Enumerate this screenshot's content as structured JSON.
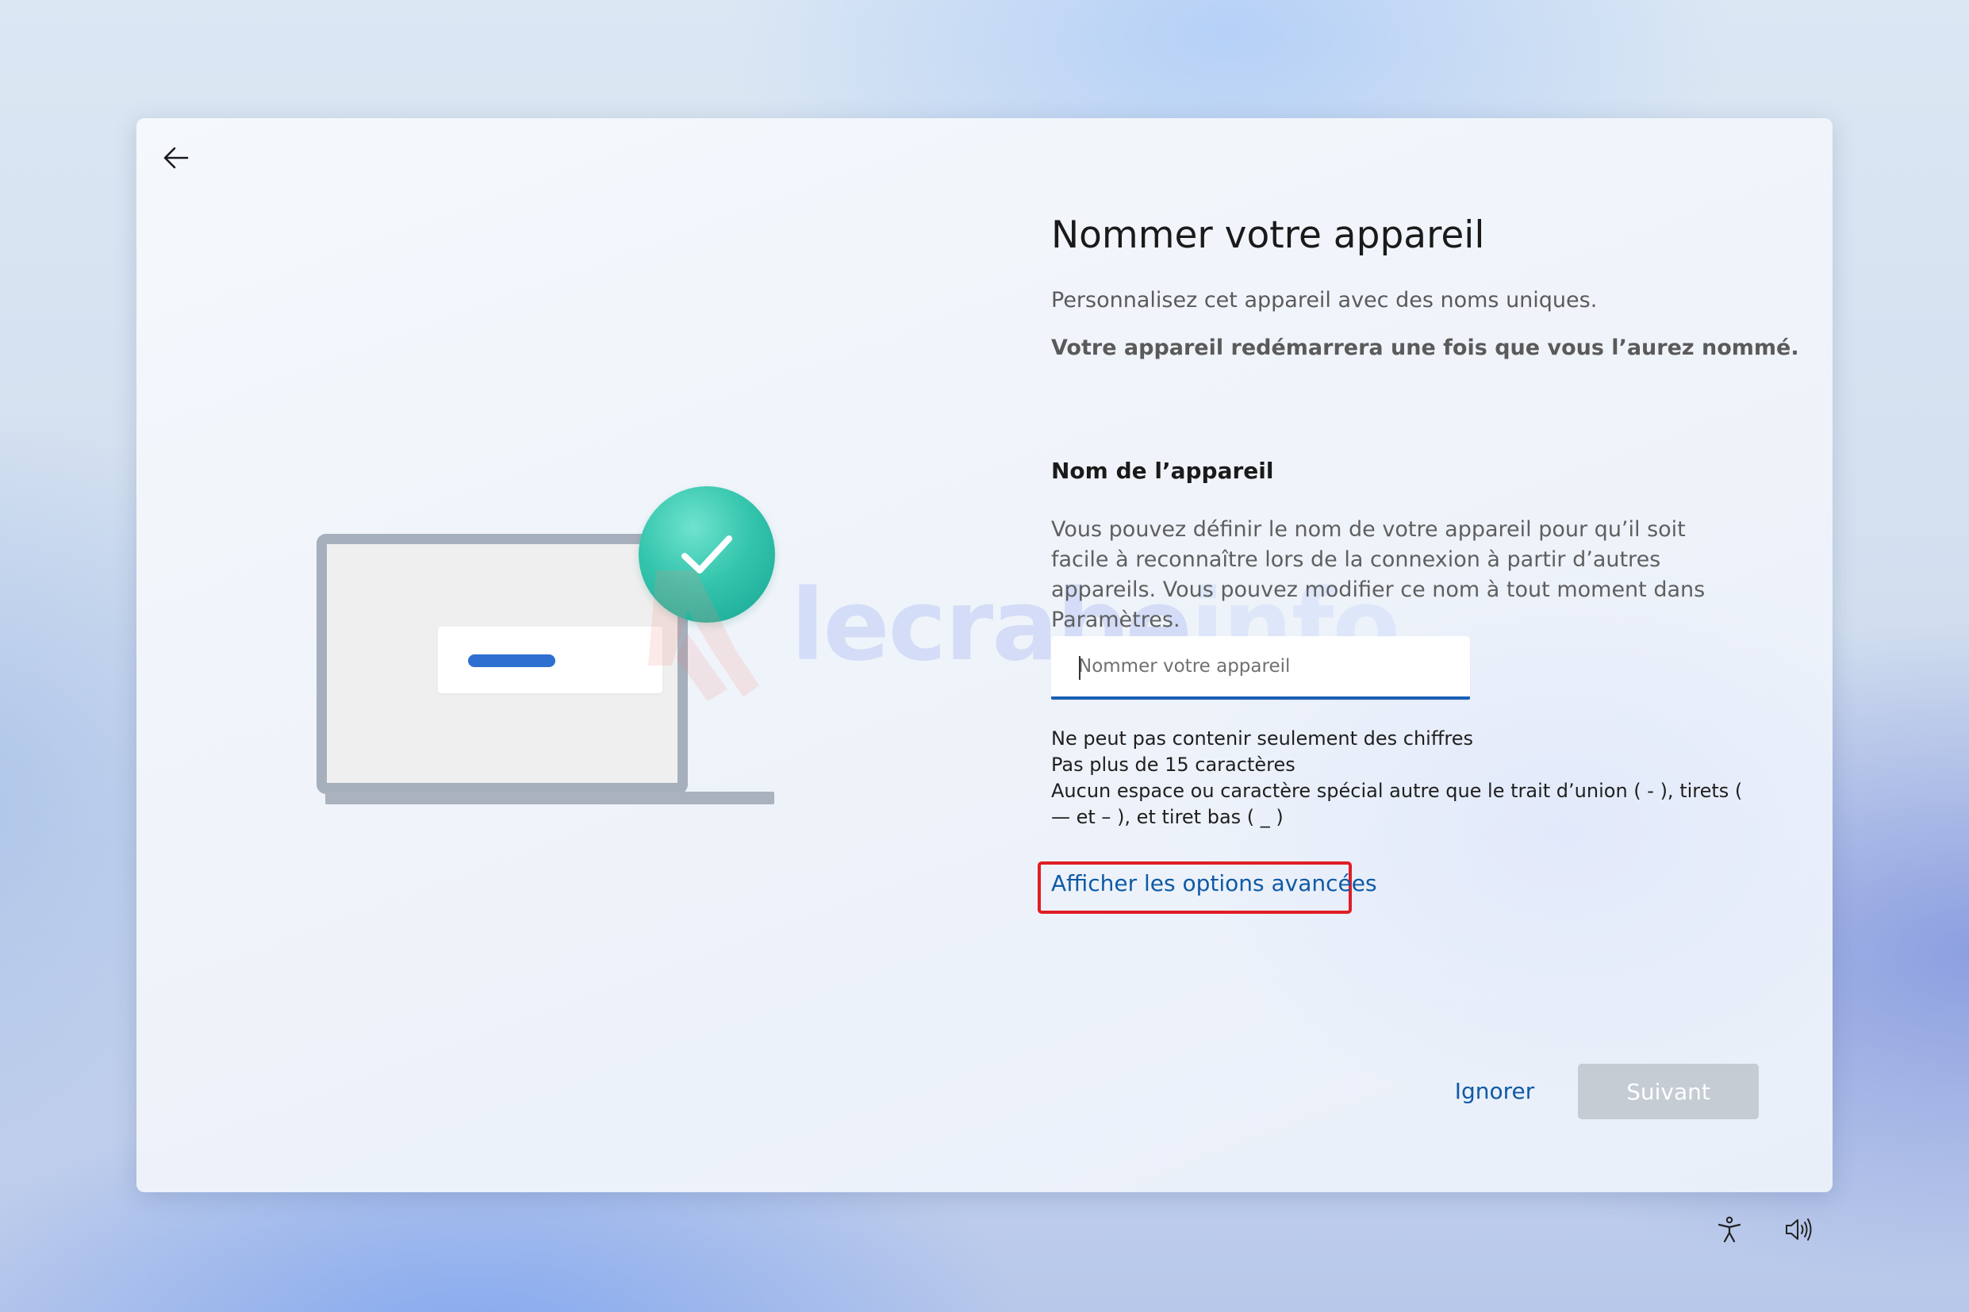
{
  "page": {
    "title": "Nommer votre appareil",
    "subtitle": "Personnalisez cet appareil avec des noms uniques.",
    "restart_note": "Votre appareil redémarrera une fois que vous l’aurez nommé."
  },
  "field": {
    "heading": "Nom de l’appareil",
    "description": "Vous pouvez définir le nom de votre appareil pour qu’il soit facile à reconnaître lors de la connexion à partir d’autres appareils. Vous pouvez modifier ce nom à tout moment dans Paramètres.",
    "placeholder": "Nommer votre appareil",
    "value": ""
  },
  "rules": [
    "Ne peut pas contenir seulement des chiffres",
    "Pas plus de 15 caractères",
    "Aucun espace ou caractère spécial autre que le trait d’union ( - ), tirets ( — et – ), et tiret bas ( _ )"
  ],
  "advanced_link": "Afficher les options avancées",
  "buttons": {
    "skip": "Ignorer",
    "next": "Suivant"
  },
  "watermark": {
    "text_main": "lecrabe",
    "text_accent": "info"
  },
  "icons": {
    "back": "arrow-left-icon",
    "check": "checkmark-icon",
    "accessibility": "accessibility-icon",
    "volume": "volume-icon"
  },
  "colors": {
    "accent": "#1a5fb4",
    "link": "#0f5aa6",
    "highlight_box": "#e01d24",
    "check_badge": "#35c5ad",
    "next_disabled": "#c6ccd4"
  }
}
